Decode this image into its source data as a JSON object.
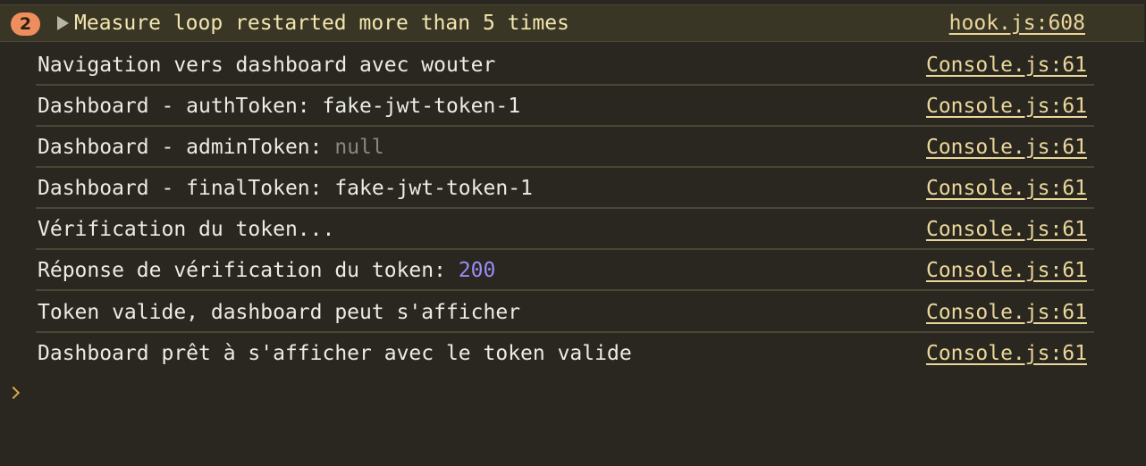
{
  "warning": {
    "count": "2",
    "message": "Measure loop restarted more than 5 times",
    "source": "hook.js:608"
  },
  "logs": [
    {
      "text": "Navigation vers dashboard avec wouter",
      "source": "Console.js:61"
    },
    {
      "text": "Dashboard - authToken: fake-jwt-token-1",
      "source": "Console.js:61"
    },
    {
      "text": "Dashboard - adminToken: ",
      "value": "null",
      "source": "Console.js:61"
    },
    {
      "text": "Dashboard - finalToken: fake-jwt-token-1",
      "source": "Console.js:61"
    },
    {
      "text": "Vérification du token...",
      "source": "Console.js:61"
    },
    {
      "text": "Réponse de vérification du token: ",
      "value": "200",
      "source": "Console.js:61"
    },
    {
      "text": "Token valide, dashboard peut s'afficher",
      "source": "Console.js:61"
    },
    {
      "text": "Dashboard prêt à s'afficher avec le token valide",
      "source": "Console.js:61"
    }
  ],
  "colors": {
    "background": "#292720",
    "warning_background": "#3a3626",
    "badge": "#ef8e5d",
    "link": "#ebd79a",
    "number": "#9b8cf6",
    "null": "#8a877c",
    "prompt": "#d9a74a"
  },
  "icons": {
    "expand": "triangle-right-icon",
    "prompt": "chevron-right-icon"
  }
}
